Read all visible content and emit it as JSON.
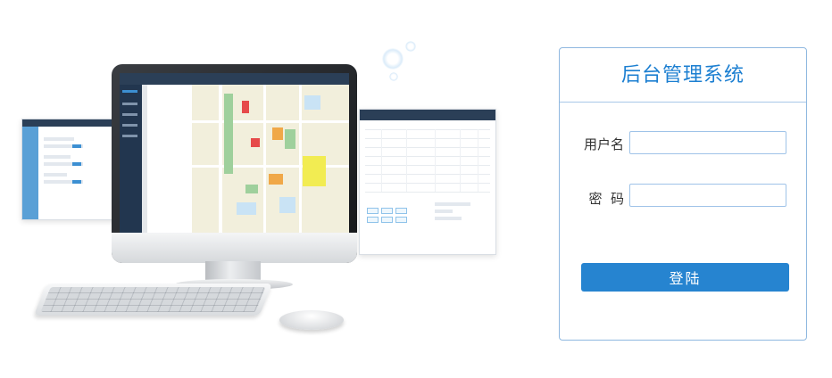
{
  "login": {
    "title": "后台管理系统",
    "username_label": "用户名",
    "username_value": "",
    "password_label": "密  码",
    "password_value": "",
    "submit_label": "登陆"
  },
  "colors": {
    "accent": "#2684d0",
    "title": "#1c7fd1",
    "border": "#8fb8e0"
  },
  "illustration": {
    "subject": "desktop computer showing admin dashboards"
  }
}
